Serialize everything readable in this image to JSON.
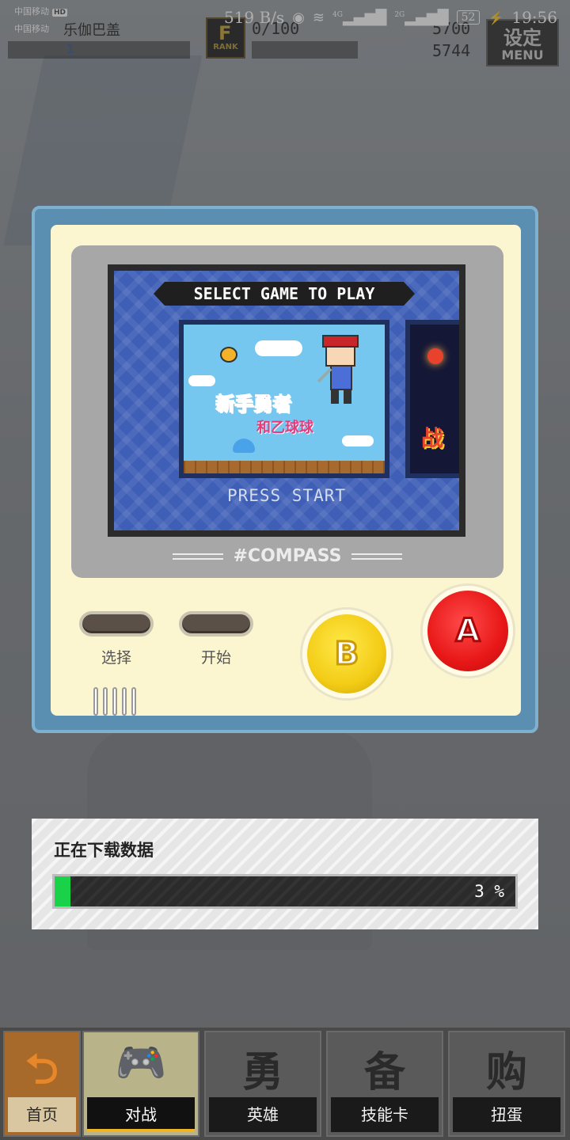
{
  "status_bar": {
    "carrier1": "中国移动",
    "carrier1_badge": "HD",
    "carrier2": "中国移动",
    "net_speed": "519 B/s",
    "eye_icon": "eye-icon",
    "wifi_icon": "wifi-icon",
    "sig1_label": "4G",
    "sig2_label": "2G",
    "battery": "52",
    "time": "19:56"
  },
  "hud": {
    "player_name": "乐伽巴盖",
    "level": "1",
    "rank_label": "RANK",
    "rank_letter": "F",
    "exp": "0/100",
    "coins": "5700",
    "gems": "5744",
    "menu_label": "MENU",
    "menu_title": "设定"
  },
  "console": {
    "select_title": "SELECT GAME TO PLAY",
    "game1_logo": "新手勇者",
    "game1_logo2": "和乙球球",
    "game2_text": "战",
    "press_start": "PRESS START",
    "brand": "#COMPASS",
    "select_label": "选择",
    "start_label": "开始",
    "b_label": "B",
    "a_label": "A"
  },
  "download": {
    "title": "正在下载数据",
    "percent_text": "3 %",
    "progress": 0.03,
    "fill_color": "#19d24a"
  },
  "tabs": [
    {
      "label": "首页",
      "icon": "back-arrow-icon",
      "glyph": "⮌"
    },
    {
      "label": "对战",
      "icon": "gamepad-icon",
      "glyph": "🎮"
    },
    {
      "label": "英雄",
      "icon": "hero-icon",
      "glyph": "勇"
    },
    {
      "label": "技能卡",
      "icon": "card-icon",
      "glyph": "备"
    },
    {
      "label": "扭蛋",
      "icon": "gacha-icon",
      "glyph": "购"
    }
  ]
}
